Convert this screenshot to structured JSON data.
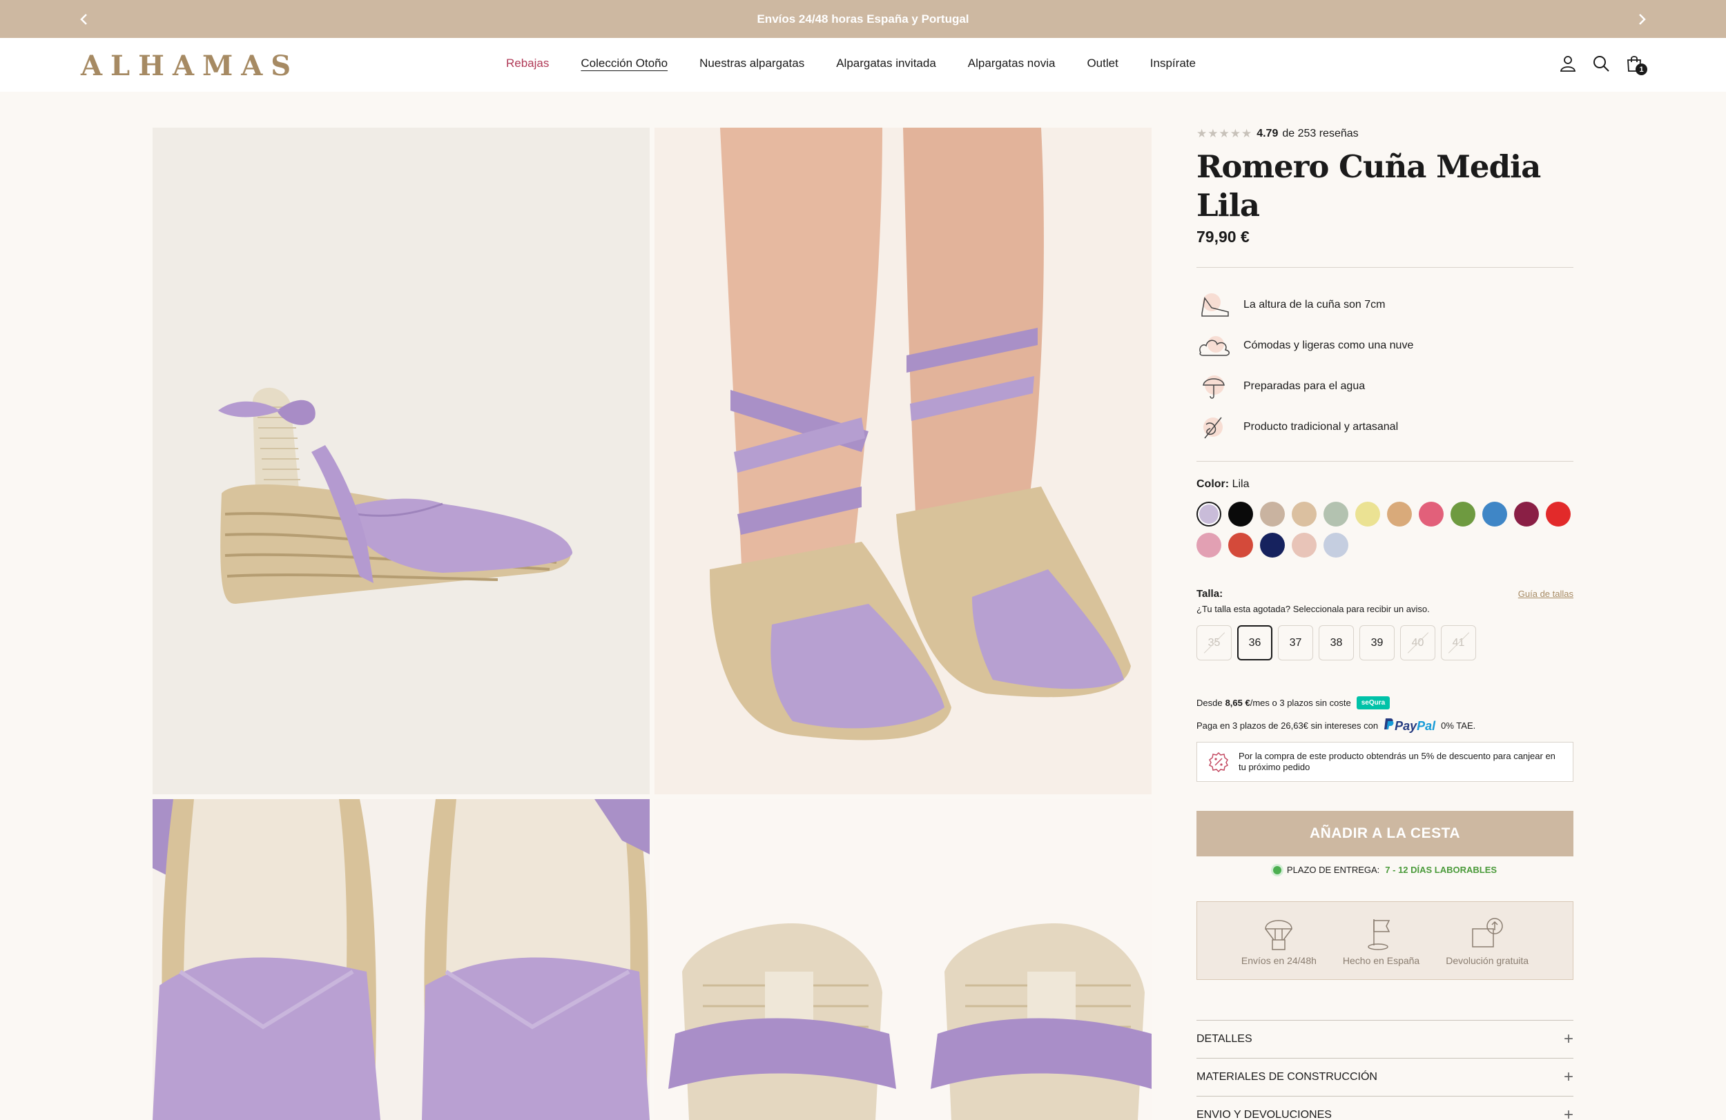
{
  "announcement": {
    "text": "Envíos 24/48 horas España y Portugal"
  },
  "logo": "ALHAMAS",
  "nav": [
    {
      "label": "Rebajas"
    },
    {
      "label": "Colección Otoño"
    },
    {
      "label": "Nuestras alpargatas"
    },
    {
      "label": "Alpargatas invitada"
    },
    {
      "label": "Alpargatas novia"
    },
    {
      "label": "Outlet"
    },
    {
      "label": "Inspírate"
    }
  ],
  "cart": {
    "count": "1"
  },
  "product": {
    "stars": "★★★★★",
    "rating": "4.79",
    "reviews_text": "de 253 reseñas",
    "title": "Romero Cuña Media Lila",
    "price": "79,90 €"
  },
  "features": [
    {
      "icon": "wedge-shoe-icon",
      "text": "La altura de la cuña son 7cm"
    },
    {
      "icon": "cloud-icon",
      "text": "Cómodas y ligeras como una nuve"
    },
    {
      "icon": "umbrella-icon",
      "text": "Preparadas para el agua"
    },
    {
      "icon": "needle-thread-icon",
      "text": "Producto tradicional y artasanal"
    }
  ],
  "color": {
    "label": "Color:",
    "value": "Lila",
    "swatches": [
      "#c9bcd9",
      "#0a0a0a",
      "#c9b3a0",
      "#dbc0a0",
      "#b3c2b0",
      "#ebe293",
      "#d9aa7a",
      "#e2607a",
      "#6e9a40",
      "#3f86c6",
      "#8a1f45",
      "#e22a2a",
      "#e2a0b3",
      "#d44a3a",
      "#16225e",
      "#e8c4b8",
      "#c5cee0"
    ]
  },
  "size": {
    "label": "Talla:",
    "guide": "Guía de tallas",
    "note": "¿Tu talla esta agotada? Seleccionala para recibir un aviso.",
    "options": [
      {
        "label": "35",
        "available": false
      },
      {
        "label": "36",
        "available": true,
        "selected": true
      },
      {
        "label": "37",
        "available": true
      },
      {
        "label": "38",
        "available": true
      },
      {
        "label": "39",
        "available": true
      },
      {
        "label": "40",
        "available": false
      },
      {
        "label": "41",
        "available": false
      }
    ]
  },
  "finance": {
    "prefix": "Desde",
    "amount": "8,65 €",
    "suffix": "/mes o 3 plazos sin coste",
    "badge": "seQura"
  },
  "paypal": {
    "text": "Paga en 3 plazos de 26,63€ sin intereses con",
    "logo_pay": "Pay",
    "logo_pal": "Pal",
    "tae": "0% TAE."
  },
  "discount": {
    "text": "Por la compra de este producto obtendrás un 5% de descuento para canjear en tu próximo pedido"
  },
  "add_to_cart": "AÑADIR A LA CESTA",
  "delivery": {
    "label": "PLAZO DE ENTREGA:",
    "days": "7 - 12 DÍAS LABORABLES"
  },
  "trust": [
    {
      "icon": "parachute-box-icon",
      "text": "Envíos en 24/48h"
    },
    {
      "icon": "flag-icon",
      "text": "Hecho en España"
    },
    {
      "icon": "return-box-icon",
      "text": "Devolución gratuita"
    }
  ],
  "accordion": [
    {
      "label": "DETALLES"
    },
    {
      "label": "MATERIALES DE CONSTRUCCIÓN"
    },
    {
      "label": "ENVIO Y DEVOLUCIONES"
    }
  ],
  "colors": {
    "accent": "#cdb8a1",
    "sale": "#b03a57",
    "brand": "#a68a63"
  }
}
